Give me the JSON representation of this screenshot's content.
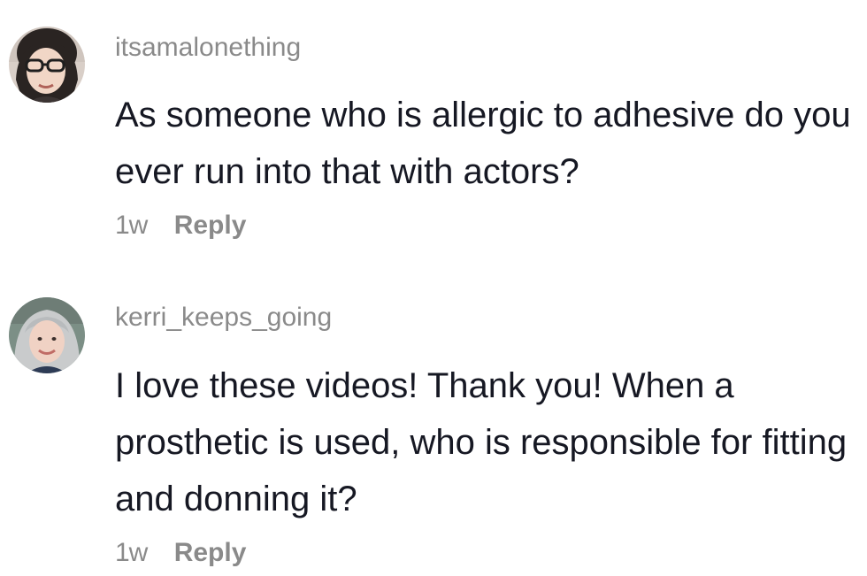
{
  "comments": [
    {
      "username": "itsamalonething",
      "text": "As someone who is allergic to adhesive do you ever run into that with actors?",
      "timestamp": "1w",
      "reply_label": "Reply",
      "avatar_icon": "profile-photo-glasses"
    },
    {
      "username": "kerri_keeps_going",
      "text": "I love these videos! Thank you! When a prosthetic is used, who is responsible for fitting and donning it?",
      "timestamp": "1w",
      "reply_label": "Reply",
      "avatar_icon": "profile-photo-gray-hair"
    }
  ],
  "colors": {
    "username": "#8a8a8a",
    "body_text": "#161823",
    "meta": "#8a8a8a"
  }
}
